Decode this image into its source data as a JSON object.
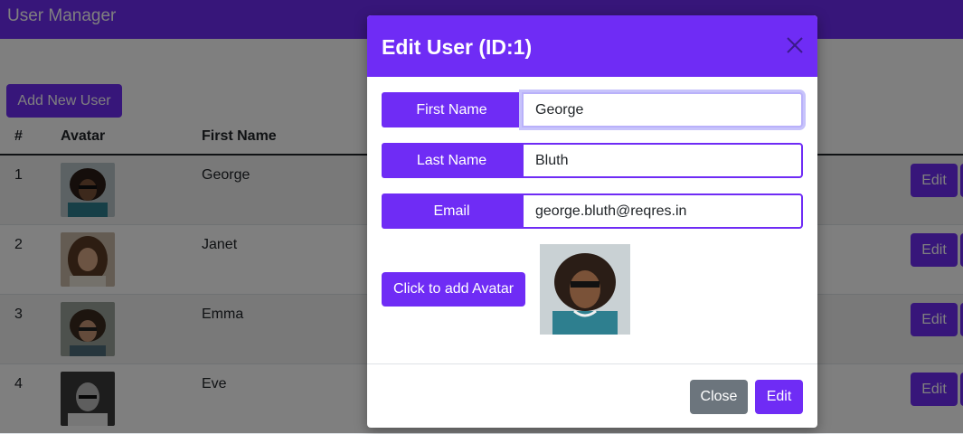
{
  "app": {
    "title": "User Manager"
  },
  "toolbar": {
    "add_label": "Add New User"
  },
  "table": {
    "headers": {
      "num": "#",
      "avatar": "Avatar",
      "first_name": "First Name"
    },
    "rows": [
      {
        "id": "1",
        "first_name": "George",
        "edit_label": "Edit"
      },
      {
        "id": "2",
        "first_name": "Janet",
        "edit_label": "Edit"
      },
      {
        "id": "3",
        "first_name": "Emma",
        "edit_label": "Edit"
      },
      {
        "id": "4",
        "first_name": "Eve",
        "edit_label": "Edit"
      }
    ]
  },
  "modal": {
    "title": "Edit User (ID:1)",
    "close_icon": "close-icon",
    "fields": {
      "first_name": {
        "label": "First Name",
        "value": "George"
      },
      "last_name": {
        "label": "Last Name",
        "value": "Bluth"
      },
      "email": {
        "label": "Email",
        "value": "george.bluth@reqres.in"
      }
    },
    "avatar_button": "Click to add Avatar",
    "close_label": "Close",
    "edit_label": "Edit"
  },
  "colors": {
    "primary": "#6f2cf5",
    "secondary": "#6c757d",
    "backdrop": "rgba(0,0,0,0.5)"
  }
}
